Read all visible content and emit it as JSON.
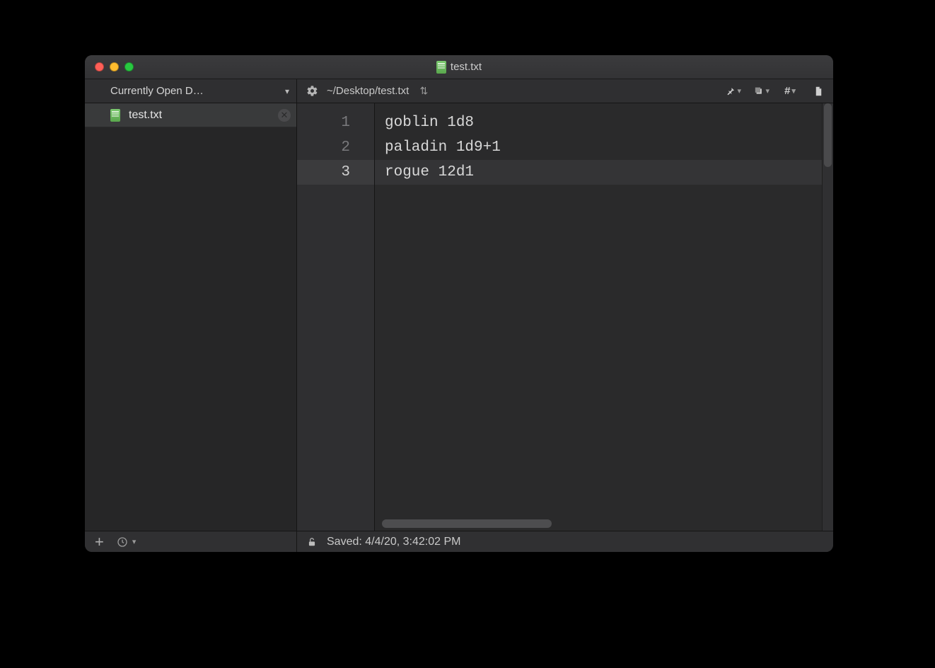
{
  "titlebar": {
    "filename": "test.txt"
  },
  "sidebar": {
    "header_label": "Currently Open D…",
    "items": [
      {
        "name": "test.txt"
      }
    ]
  },
  "toolbar": {
    "path": "~/Desktop/test.txt",
    "icons": {
      "gear": "gear",
      "sort": "⇅",
      "pin": "pin",
      "stack": "stack",
      "hash": "#",
      "doc": "doc"
    }
  },
  "editor": {
    "current_line_index": 2,
    "lines": [
      {
        "num": "1",
        "text": "goblin 1d8"
      },
      {
        "num": "2",
        "text": "paladin 1d9+1"
      },
      {
        "num": "3",
        "text": "rogue 12d1"
      }
    ]
  },
  "status": {
    "saved_label": "Saved: 4/4/20, 3:42:02 PM"
  }
}
